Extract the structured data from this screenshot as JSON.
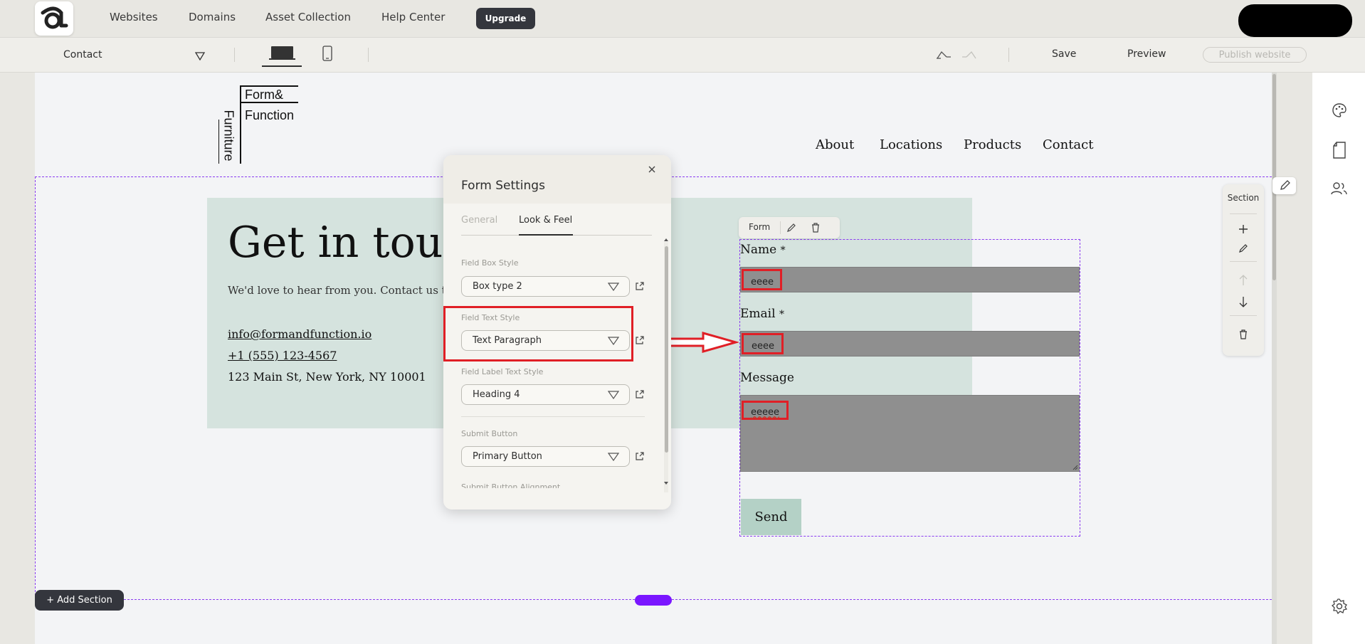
{
  "topnav": {
    "links": [
      "Websites",
      "Domains",
      "Asset Collection",
      "Help Center"
    ],
    "upgrade_label": "Upgrade"
  },
  "toolbar": {
    "page_selector": "Contact",
    "save_label": "Save",
    "preview_label": "Preview",
    "publish_label": "Publish website"
  },
  "site": {
    "logo_top": "Form&",
    "logo_mid": "Function",
    "logo_side": "Furniture",
    "nav": [
      "About",
      "Locations",
      "Products",
      "Contact"
    ]
  },
  "contact": {
    "heading": "Get in touc",
    "subtitle": "We'd love to hear from you. Contact us tod",
    "email": "info@formandfunction.io",
    "phone": "+1 (555) 123-4567",
    "address": "123 Main St, New York, NY 10001"
  },
  "form": {
    "toolbar_label": "Form",
    "name_label": "Name",
    "email_label": "Email",
    "message_label": "Message",
    "required_mark": "*",
    "name_value": "eeee",
    "email_value": "eeee",
    "message_value": "eeeee",
    "send_label": "Send"
  },
  "modal": {
    "title": "Form Settings",
    "tabs": [
      "General",
      "Look & Feel"
    ],
    "active_tab": "Look & Feel",
    "fields": [
      {
        "heading": "Field Box Style",
        "value": "Box type 2"
      },
      {
        "heading": "Field Text Style",
        "value": "Text Paragraph"
      },
      {
        "heading": "Field Label Text Style",
        "value": "Heading 4"
      },
      {
        "heading": "Submit Button",
        "value": "Primary Button"
      }
    ],
    "cutoff_heading": "Submit Button Alignment"
  },
  "section_tools": {
    "label": "Section"
  },
  "canvas": {
    "add_section_label": "+ Add Section"
  },
  "colors": {
    "accent": "#8b3cf0",
    "highlight": "#e01f26",
    "panel": "#d5e3de",
    "field": "#8f8f8f",
    "dark": "#34363d"
  }
}
